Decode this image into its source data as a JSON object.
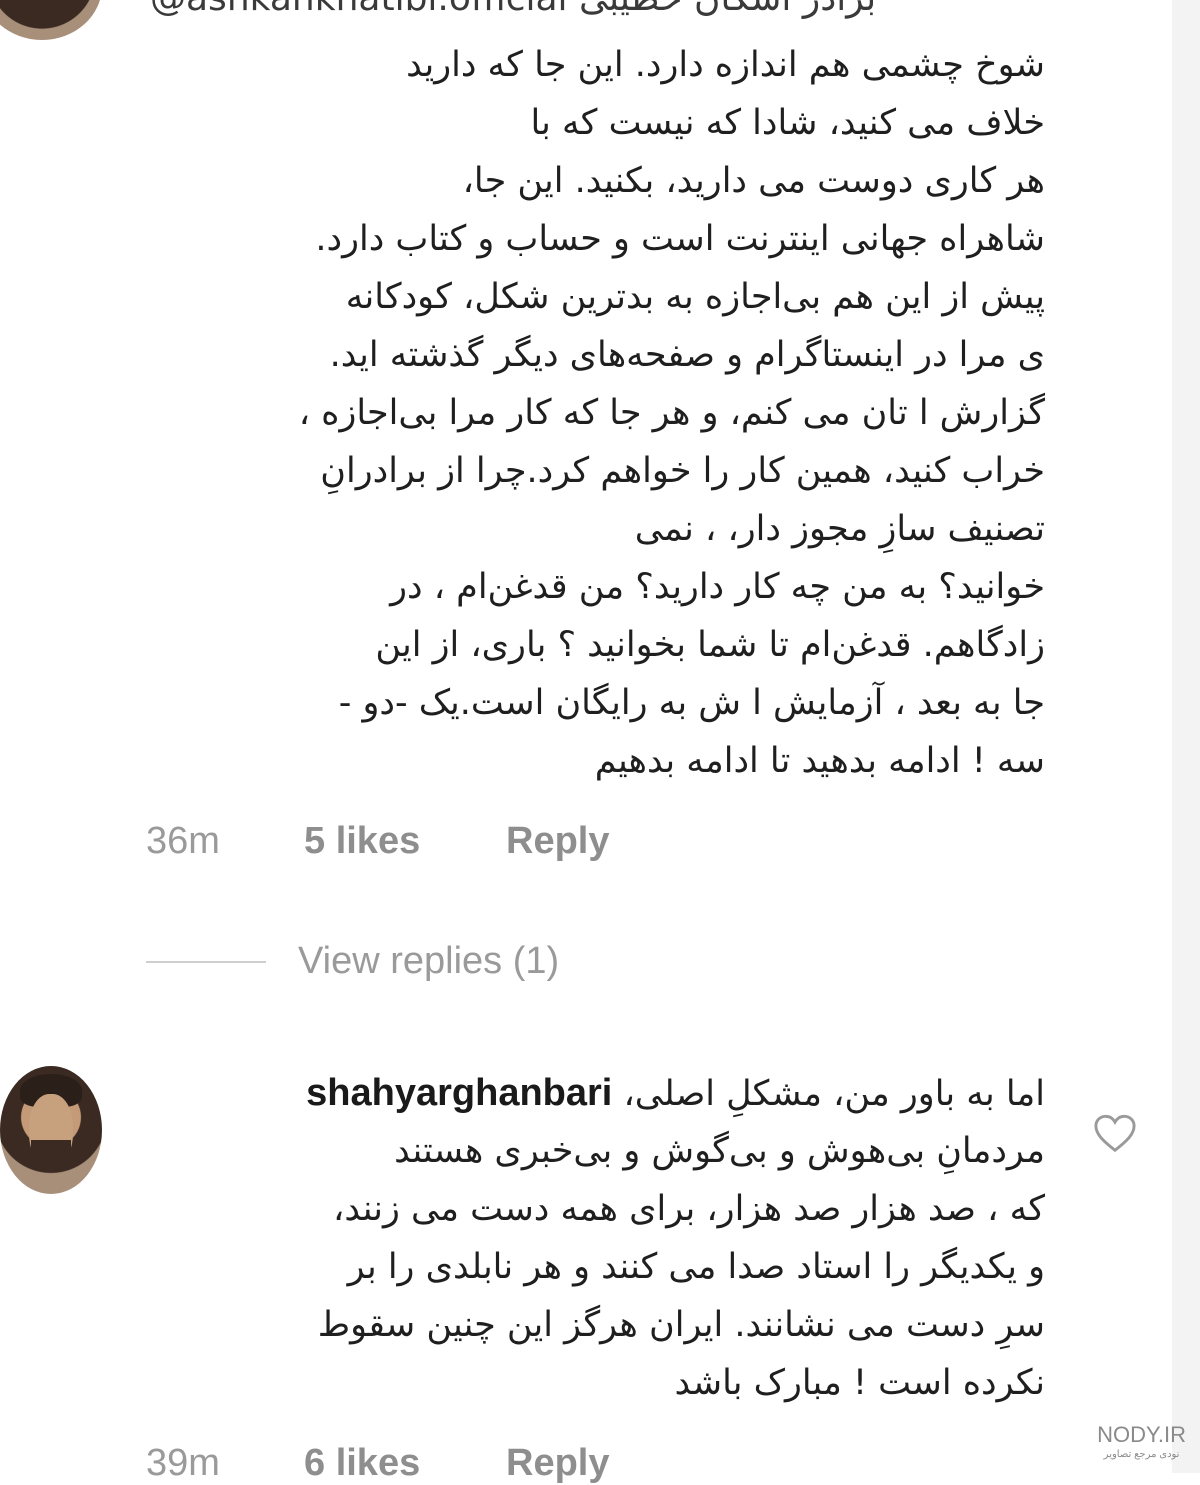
{
  "comment_1": {
    "username_line": "@ashkankhatibi.official  برادر اشکان خطیبی",
    "lines": [
      "شوخ چشمی هم اندازه  دارد. این جا که دارید",
      "خلاف می کنید، شادا که               نیست که با",
      "هر کاری دوست می دارید، بکنید. این جا،",
      "شاهراه جهانی اینترنت است و حساب و کتاب دارد.",
      "پیش از این هم بی‌اجازه به بدترین شکل، کودکانه",
      "ی مرا در اینستاگرام و صفحه‌های دیگر گذشته اید.",
      "گزارش ا تان می کنم، و هر جا که کار مرا بی‌اجازه ،",
      "خراب کنید، همین کار را خواهم کرد.چرا از برادرانِ",
      "تصنیف سازِ مجوز دار،                     ، نمی",
      "خوانید؟ به من چه کار دارید؟ من قدغن‌ام ، در",
      "زادگاهم. قدغن‌ام تا شما بخوانید ؟ باری، از این",
      "جا به بعد ،  آزمایش ا ش به رایگان است.یک -دو -",
      "سه ! ادامه بدهید تا ادامه بدهیم"
    ],
    "time": "36m",
    "likes": "5 likes",
    "reply": "Reply",
    "view_replies": "View replies (1)"
  },
  "comment_2": {
    "username": "shahyarghanbari",
    "lines": [
      "اما به باور من، مشکلِ اصلی،",
      "مردمانِ بی‌هوش و بی‌گوش و بی‌خبری هستند",
      "که ، صد هزار صد هزار، برای همه دست می زنند،",
      "و یکدیگر را استاد صدا می کنند و هر نابلدی را بر",
      "سرِ دست می نشانند. ایران هرگز این چنین سقوط",
      "نکرده است ! مبارک باشد"
    ],
    "time": "39m",
    "likes": "6 likes",
    "reply": "Reply",
    "like_icon": "heart-outline-icon"
  },
  "watermark": {
    "text": "NODY.IR",
    "subtext": "نودی مرجع تصاویر"
  }
}
